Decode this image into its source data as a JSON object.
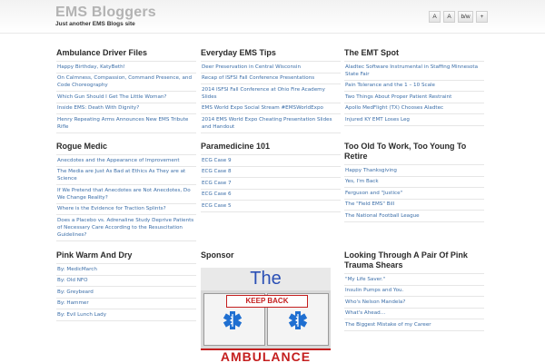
{
  "site": {
    "title": "EMS Bloggers",
    "tagline": "Just another EMS Blogs site"
  },
  "font_controls": [
    "A",
    "A",
    "b/w",
    "+"
  ],
  "widgets": [
    {
      "title": "Ambulance Driver Files",
      "items": [
        "Happy Birthday, KatyBeth!",
        "On Calmness, Compassion, Command Presence, and Code Choreography",
        "Which Gun Should I Get The Little Woman?",
        "Inside EMS: Death With Dignity?",
        "Henry Repeating Arms Announces New EMS Tribute Rifle"
      ]
    },
    {
      "title": "Everyday EMS Tips",
      "items": [
        "Deer Preservation in Central Wisconsin",
        "Recap of ISFSI Fall Conference Presentations",
        "2014 ISFSI Fall Conference at Ohio Fire Academy Slides",
        "EMS World Expo Social Stream #EMSWorldExpo",
        "2014 EMS World Expo Cheating Presentation Slides and Handout"
      ]
    },
    {
      "title": "The EMT Spot",
      "items": [
        "Aladtec Software Instrumental in Staffing Minnesota State Fair",
        "Pain Tolerance and the 1 – 10 Scale",
        "Two Things About Proper Patient Restraint",
        "Apollo MedFlight (TX) Chooses Aladtec",
        "Injured KY EMT Loses Leg"
      ]
    },
    {
      "title": "Rogue Medic",
      "items": [
        "Anecdotes and the Appearance of Improvement",
        "The Media are Just As Bad at Ethics As They are at Science",
        "If We Pretend that Anecdotes are Not Anecdotes, Do We Change Reality?",
        "Where is the Evidence for Traction Splints?",
        "Does a Placebo vs. Adrenaline Study Deprive Patients of Necessary Care According to the Resuscitation Guidelines?"
      ]
    },
    {
      "title": "Paramedicine 101",
      "items": [
        "ECG Case 9",
        "ECG Case 8",
        "ECG Case 7",
        "ECG Case 6",
        "ECG Case 5"
      ]
    },
    {
      "title": "Too Old To Work, Too Young To Retire",
      "items": [
        "Happy Thanksgiving",
        "Yes, I'm Back",
        "Ferguson and \"Justice\"",
        "The \"Field EMS\" Bill",
        "The National Football League"
      ]
    },
    {
      "title": "Pink Warm And Dry",
      "items": [
        "By: MedicMarch",
        "By: Old NFO",
        "By: Greybeard",
        "By: Hammer",
        "By: Evil Lunch Lady"
      ]
    },
    {
      "title": "Sponsor",
      "items": []
    },
    {
      "title": "Looking Through A Pair Of Pink Trauma Shears",
      "items": [
        "\"My Life Saver.\"",
        "Insulin Pumps and You.",
        "Who's Nelson Mandela?",
        "What's Ahead…",
        "The Biggest Mistake of my Career"
      ]
    }
  ],
  "sponsor": {
    "headline": "The",
    "banner": "KEEP BACK",
    "vehicle_text": "AMBULANCE"
  }
}
